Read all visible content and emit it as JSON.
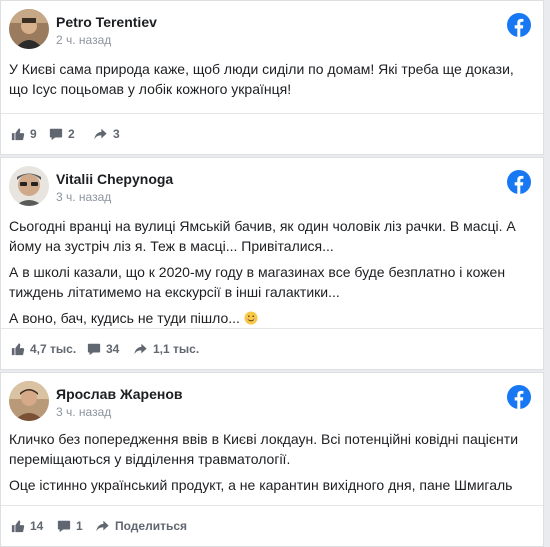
{
  "posts": [
    {
      "author": "Petro Terentiev",
      "time": "2 ч. назад",
      "paragraphs": [
        "У Києві сама природа каже, щоб люди сиділи по домам! Які треба ще докази, що Ісус поцьомав у лобік кожного українця!"
      ],
      "likes": "9",
      "comments": "2",
      "shares": "3"
    },
    {
      "author": "Vitalii Chepynoga",
      "time": "3 ч. назад",
      "paragraphs": [
        "Сьогодні вранці на вулиці Ямській бачив, як один чоловік ліз рачки. В масці. А йому на зустріч ліз я. Теж в масці... Привіталися...",
        "А в школі казали, що к 2020-му году в магазинах все буде безплатно і кожен тиждень літатимемо на екскурсії в інші галактики...",
        "А воно, бач, кудись не туди пішло..."
      ],
      "likes": "4,7 тыс.",
      "comments": "34",
      "shares": "1,1 тыс."
    },
    {
      "author": "Ярослав Жаренов",
      "time": "3 ч. назад",
      "paragraphs": [
        "Кличко без попередження ввів в Києві локдаун. Всі потенційні ковідні пацієнти переміщаються у відділення травматології.",
        "Оце істинно український продукт, а не карантин вихідного дня, пане Шмигаль"
      ],
      "likes": "14",
      "comments": "1",
      "shares": "Поделиться"
    }
  ],
  "icons": {
    "brand": "facebook-icon",
    "like": "thumbs-up-icon",
    "comment": "comment-icon",
    "share": "share-arrow-icon",
    "emoji": "smiling-face-icon"
  },
  "colors": {
    "facebook_blue": "#1877f2",
    "stat_gray": "#606770",
    "time_gray": "#8d949e"
  }
}
